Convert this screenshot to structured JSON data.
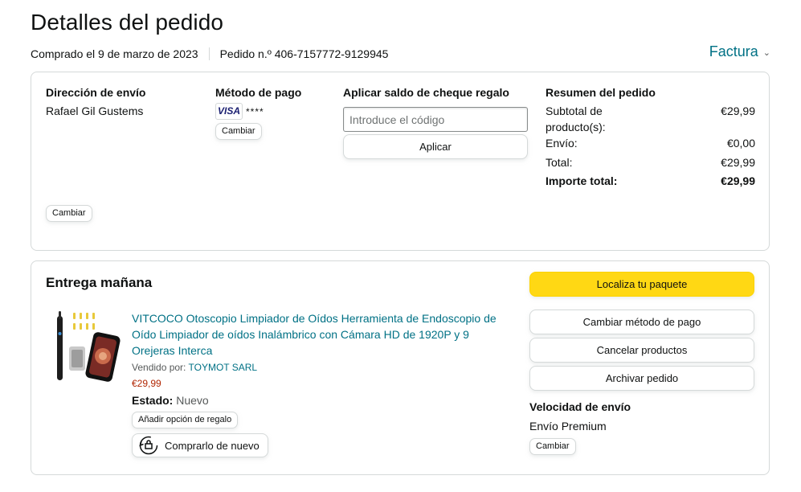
{
  "header": {
    "title": "Detalles del pedido",
    "purchased": "Comprado el 9 de marzo de 2023",
    "order_number": "Pedido n.º 406-7157772-9129945",
    "invoice_label": "Factura"
  },
  "shipping": {
    "title": "Dirección de envío",
    "name": "Rafael Gil Gustems",
    "change_label": "Cambiar"
  },
  "payment": {
    "title": "Método de pago",
    "card_brand": "VISA",
    "card_mask": "****",
    "change_label": "Cambiar"
  },
  "gift": {
    "title": "Aplicar saldo de cheque regalo",
    "placeholder": "Introduce el código",
    "apply_label": "Aplicar"
  },
  "summary": {
    "title": "Resumen del pedido",
    "rows": [
      {
        "label": "Subtotal de producto(s):",
        "value": "€29,99"
      },
      {
        "label": "Envío:",
        "value": "€0,00"
      },
      {
        "label": "Total:",
        "value": "€29,99"
      }
    ],
    "grand_total_label": "Importe total:",
    "grand_total_value": "€29,99"
  },
  "delivery": {
    "title": "Entrega mañana",
    "product": {
      "title": "VITCOCO Otoscopio Limpiador de Oídos Herramienta de Endoscopio de Oído Limpiador de oídos Inalámbrico con Cámara HD de 1920P y 9 Orejeras Interca",
      "sold_by_label": "Vendido por:",
      "seller": "TOYMOT SARL",
      "price": "€29,99",
      "condition_label": "Estado:",
      "condition": "Nuevo",
      "gift_option_label": "Añadir opción de regalo",
      "buy_again_label": "Comprarlo de nuevo"
    },
    "actions": {
      "track": "Localiza tu paquete",
      "change_payment": "Cambiar método de pago",
      "cancel": "Cancelar productos",
      "archive": "Archivar pedido"
    },
    "speed": {
      "title": "Velocidad de envío",
      "value": "Envío Premium",
      "change_label": "Cambiar"
    }
  },
  "colors": {
    "link": "#007185",
    "price": "#b12704",
    "primary_button": "#ffd814",
    "border": "#d5d9d9"
  }
}
